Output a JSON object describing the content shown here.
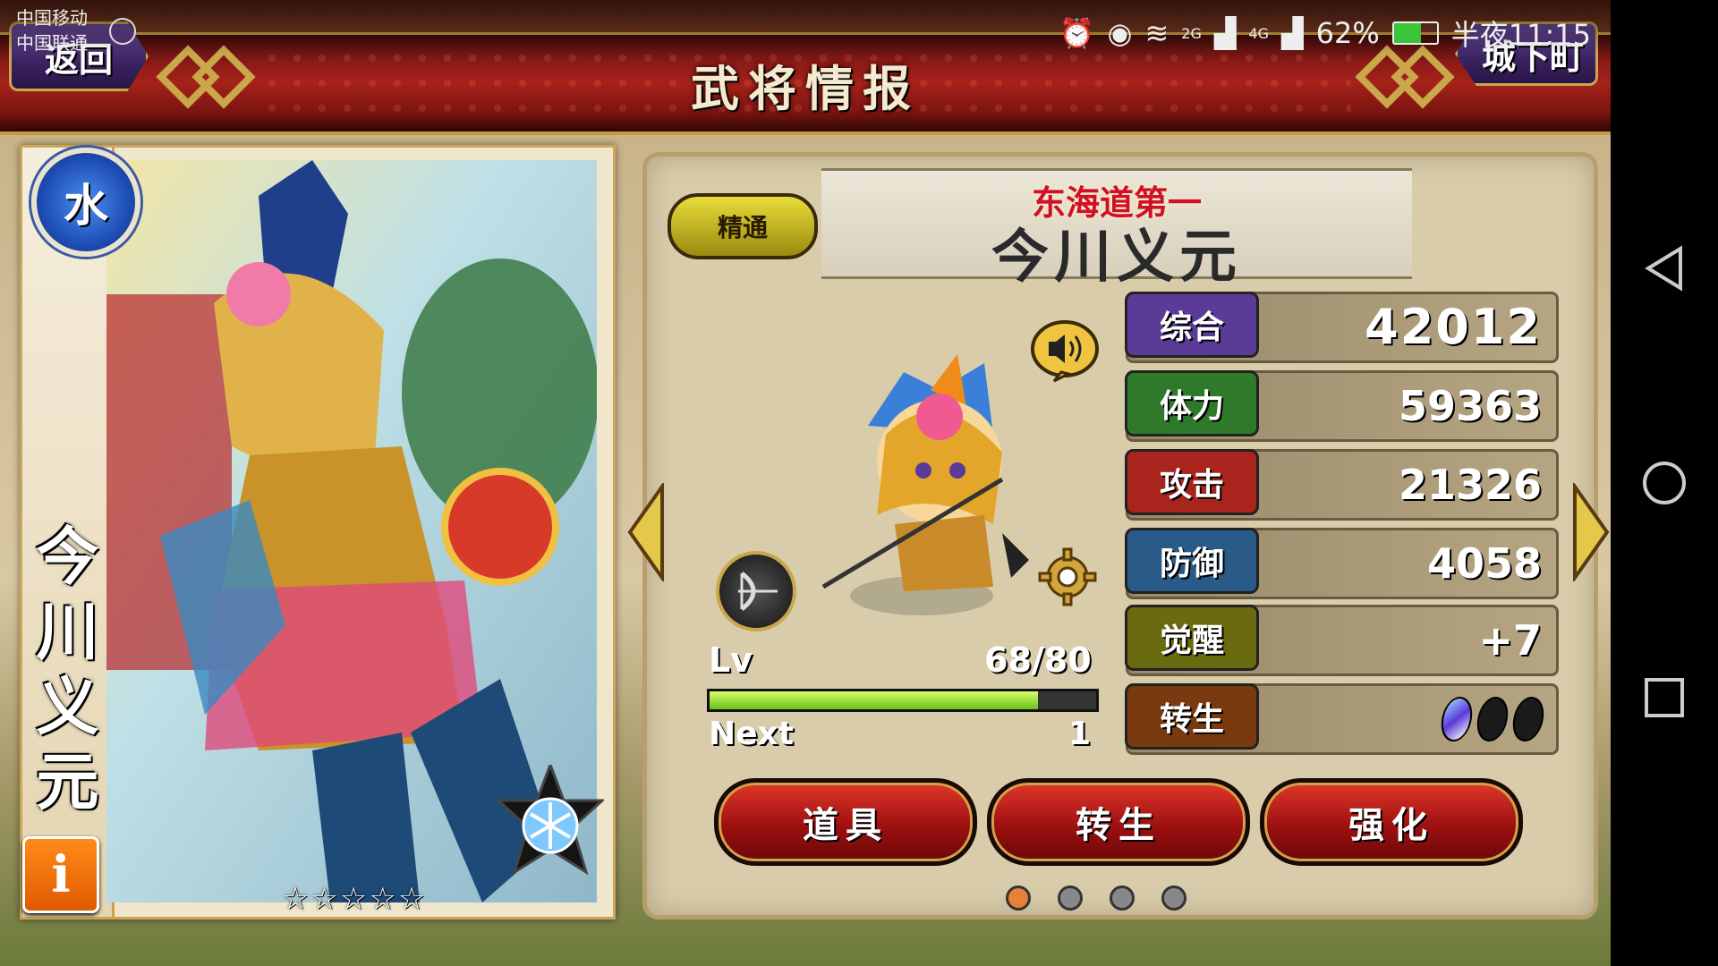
{
  "status_bar": {
    "carrier_1": "中国移动",
    "carrier_2": "中国联通",
    "network_a": "2G",
    "network_b": "4G",
    "battery": "62%",
    "time": "半夜11:15"
  },
  "header": {
    "title": "武将情报",
    "back_label": "返回",
    "town_label": "城下町"
  },
  "card": {
    "element": "水",
    "name": "今川义元",
    "info_label": "i",
    "stars": "☆☆☆☆☆",
    "rarity": 5
  },
  "warlord": {
    "rank": "精通",
    "epithet": "东海道第一",
    "name": "今川义元"
  },
  "stats": [
    {
      "label": "综合",
      "value": "42012",
      "color": "#5a3c98"
    },
    {
      "label": "体力",
      "value": "59363",
      "color": "#2f7a2a"
    },
    {
      "label": "攻击",
      "value": "21326",
      "color": "#a8241c"
    },
    {
      "label": "防御",
      "value": "4058",
      "color": "#2a5a88"
    },
    {
      "label": "觉醒",
      "value": "+7",
      "color": "#6a6a10"
    },
    {
      "label": "转生",
      "value": "",
      "color": "#7a3a10"
    }
  ],
  "rebirth_gems": {
    "filled": 1,
    "total": 3
  },
  "level": {
    "label": "Lv",
    "value": "68/80",
    "progress": 0.85,
    "next_label": "Next",
    "next_value": "1"
  },
  "actions": [
    "道具",
    "转生",
    "强化"
  ],
  "pagination": {
    "count": 4,
    "active": 0
  },
  "icons": {
    "sound": "speaker-icon",
    "weapon": "bow-skill-icon",
    "settings": "gear-icon",
    "left": "arrow-left-icon",
    "right": "arrow-right-icon"
  }
}
